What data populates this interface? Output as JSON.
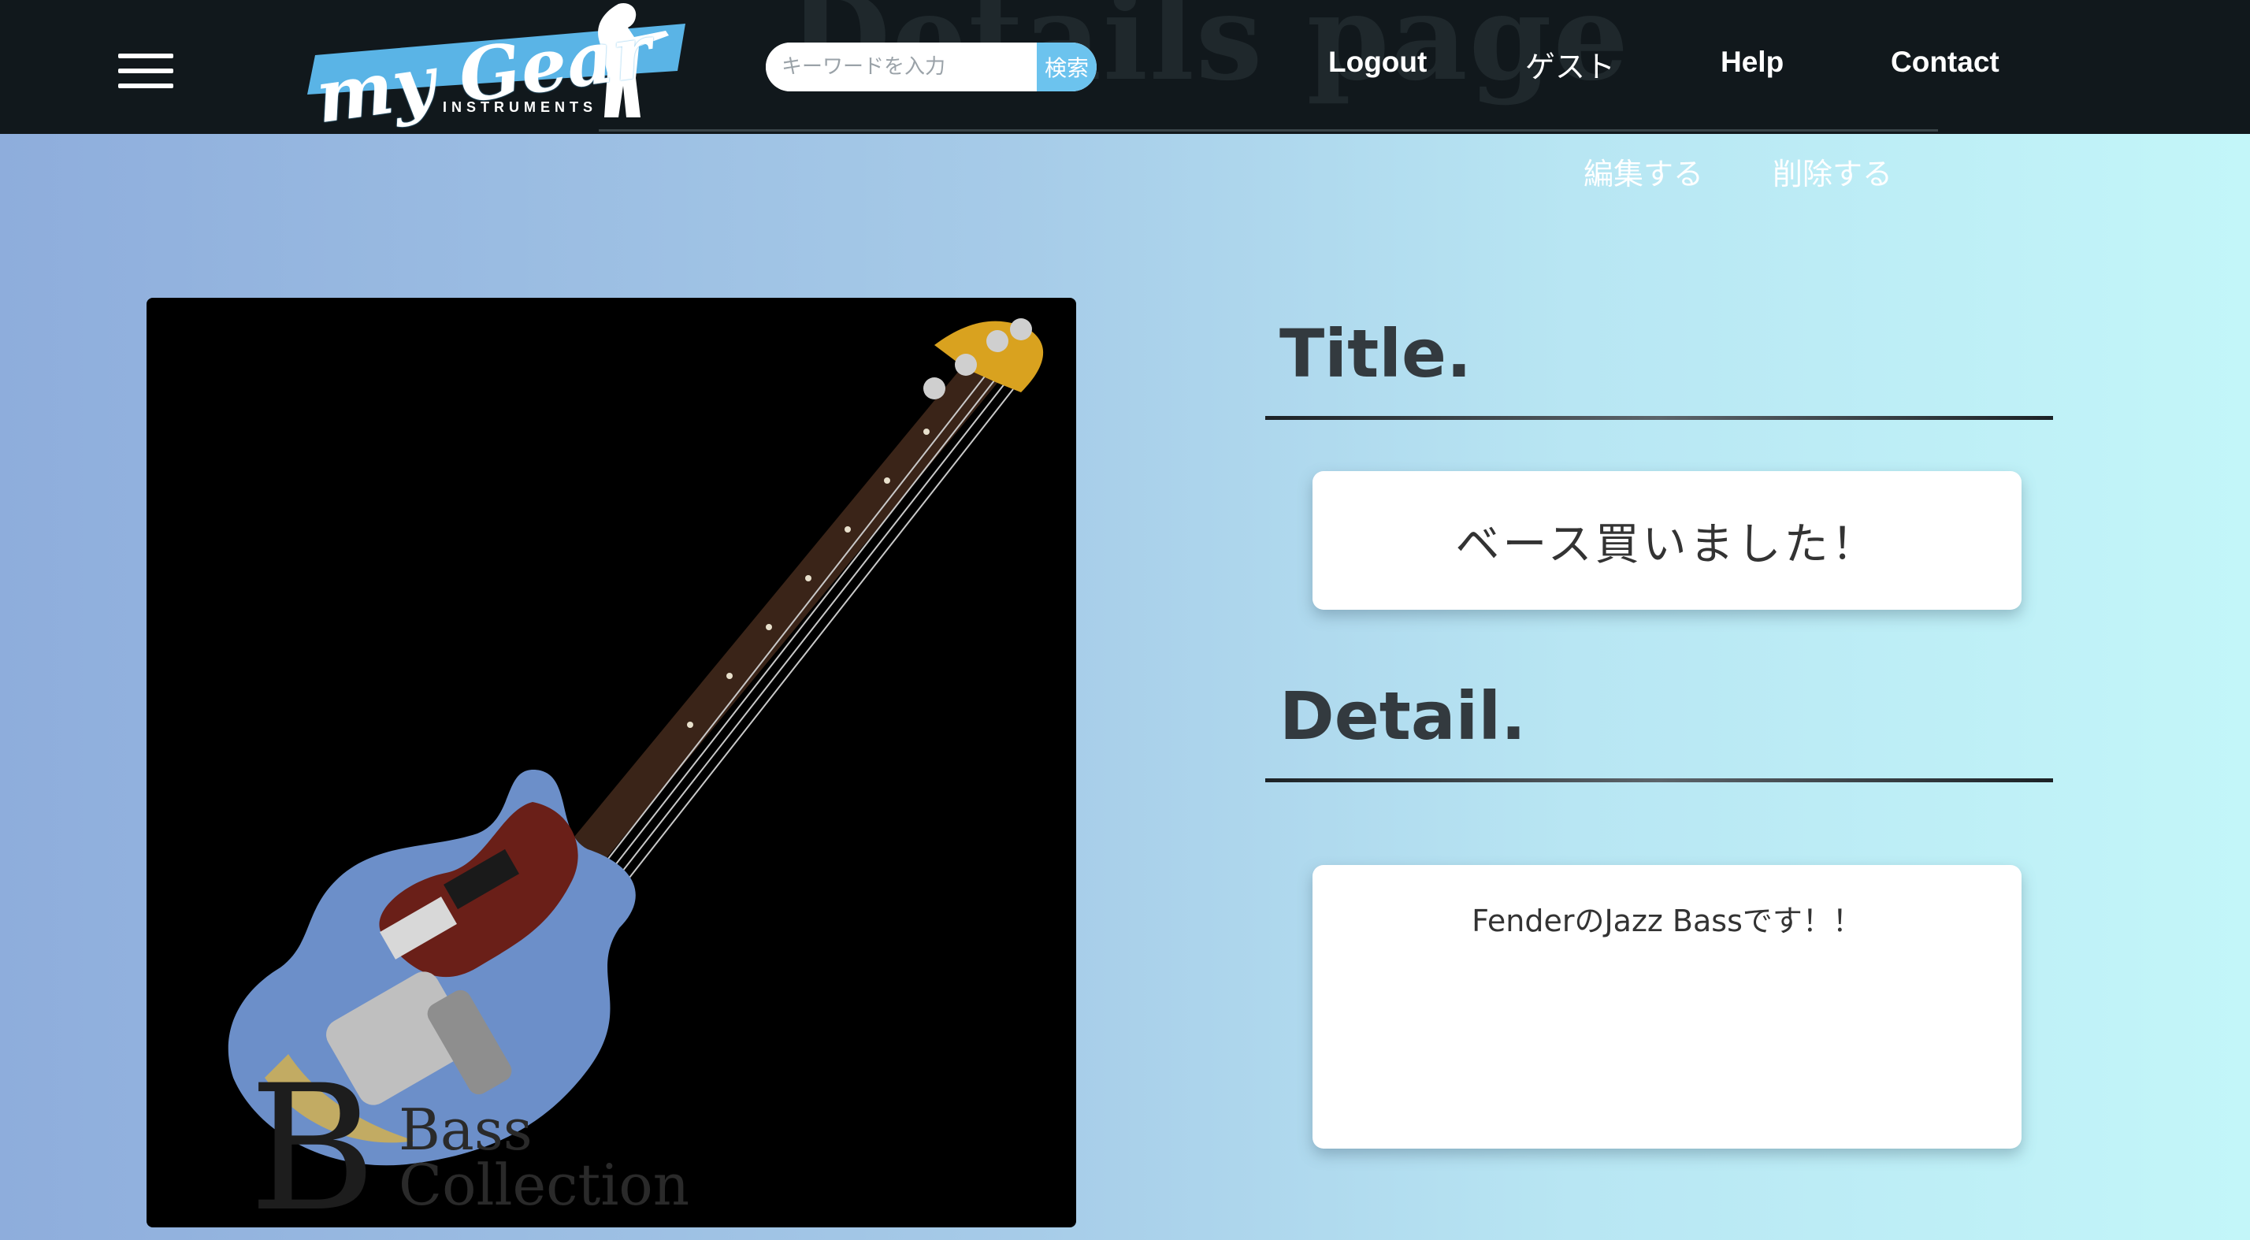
{
  "header": {
    "ghost_title": "Details page",
    "logo": {
      "text": "my Gear",
      "subtitle": "INSTRUMENTS"
    },
    "search": {
      "placeholder": "キーワードを入力",
      "button_label": "検索"
    },
    "nav": {
      "logout": "Logout",
      "guest": "ゲスト",
      "help": "Help",
      "contact": "Contact"
    }
  },
  "actions": {
    "edit": "編集する",
    "delete": "削除する"
  },
  "photo": {
    "subject": "bass-guitar",
    "watermark_line1": "Bass",
    "watermark_line2": "Collection"
  },
  "content": {
    "title_heading": "Title.",
    "title_value": "ベース買いました！",
    "detail_heading": "Detail.",
    "detail_value": "FenderのJazz Bassです！！"
  },
  "colors": {
    "header_bg": "#11181c",
    "search_button": "#6cc3ee",
    "heading_text": "#333a3f",
    "gradient_start": "#8eaddc",
    "gradient_end": "#c3f6f9"
  }
}
